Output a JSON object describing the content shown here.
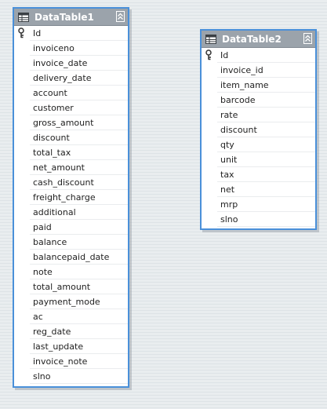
{
  "tables": [
    {
      "title": "DataTable1",
      "icon": "table-icon",
      "key_icon": "primary-key-icon",
      "columns": [
        "Id",
        "invoiceno",
        "invoice_date",
        "delivery_date",
        "account",
        "customer",
        "gross_amount",
        "discount",
        "total_tax",
        "net_amount",
        "cash_discount",
        "freight_charge",
        "additional",
        "paid",
        "balance",
        "balancepaid_date",
        "note",
        "total_amount",
        "payment_mode",
        "ac",
        "reg_date",
        "last_update",
        "invoice_note",
        "slno"
      ]
    },
    {
      "title": "DataTable2",
      "icon": "table-icon",
      "key_icon": "primary-key-icon",
      "columns": [
        "Id",
        "invoice_id",
        "item_name",
        "barcode",
        "rate",
        "discount",
        "qty",
        "unit",
        "tax",
        "net",
        "mrp",
        "slno"
      ]
    }
  ],
  "colors": {
    "border_accent": "#4a90d9",
    "header_background": "#9ba3ab",
    "canvas_background": "#e9edef"
  }
}
